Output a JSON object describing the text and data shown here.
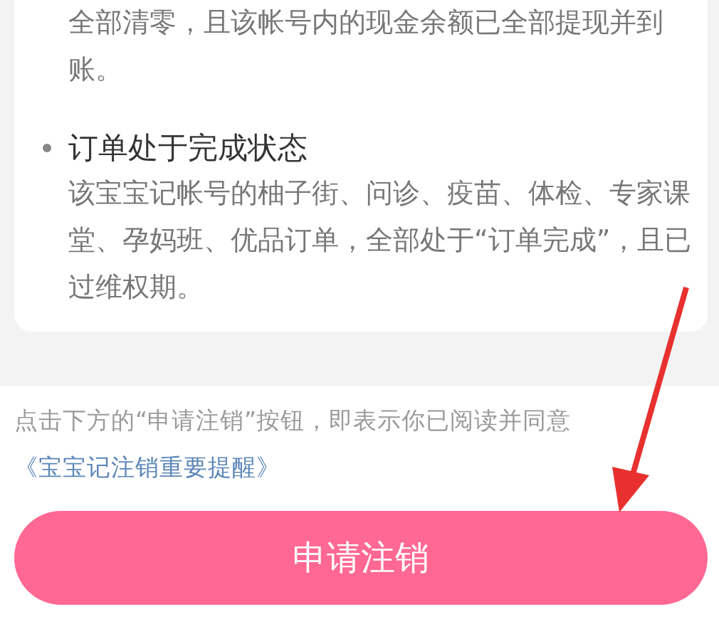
{
  "card": {
    "items": [
      {
        "body": "全部清零，且该帐号内的现金余额已全部提现并到账。"
      },
      {
        "title": "订单处于完成状态",
        "body": "该宝宝记帐号的柚子街、问诊、疫苗、体检、专家课堂、孕妈班、优品订单，全部处于“订单完成”，且已过维权期。"
      }
    ]
  },
  "notice": {
    "text": "点击下方的“申请注销”按钮，即表示你已阅读并同意",
    "link": "《宝宝记注销重要提醒》"
  },
  "submit_button": "申请注销"
}
